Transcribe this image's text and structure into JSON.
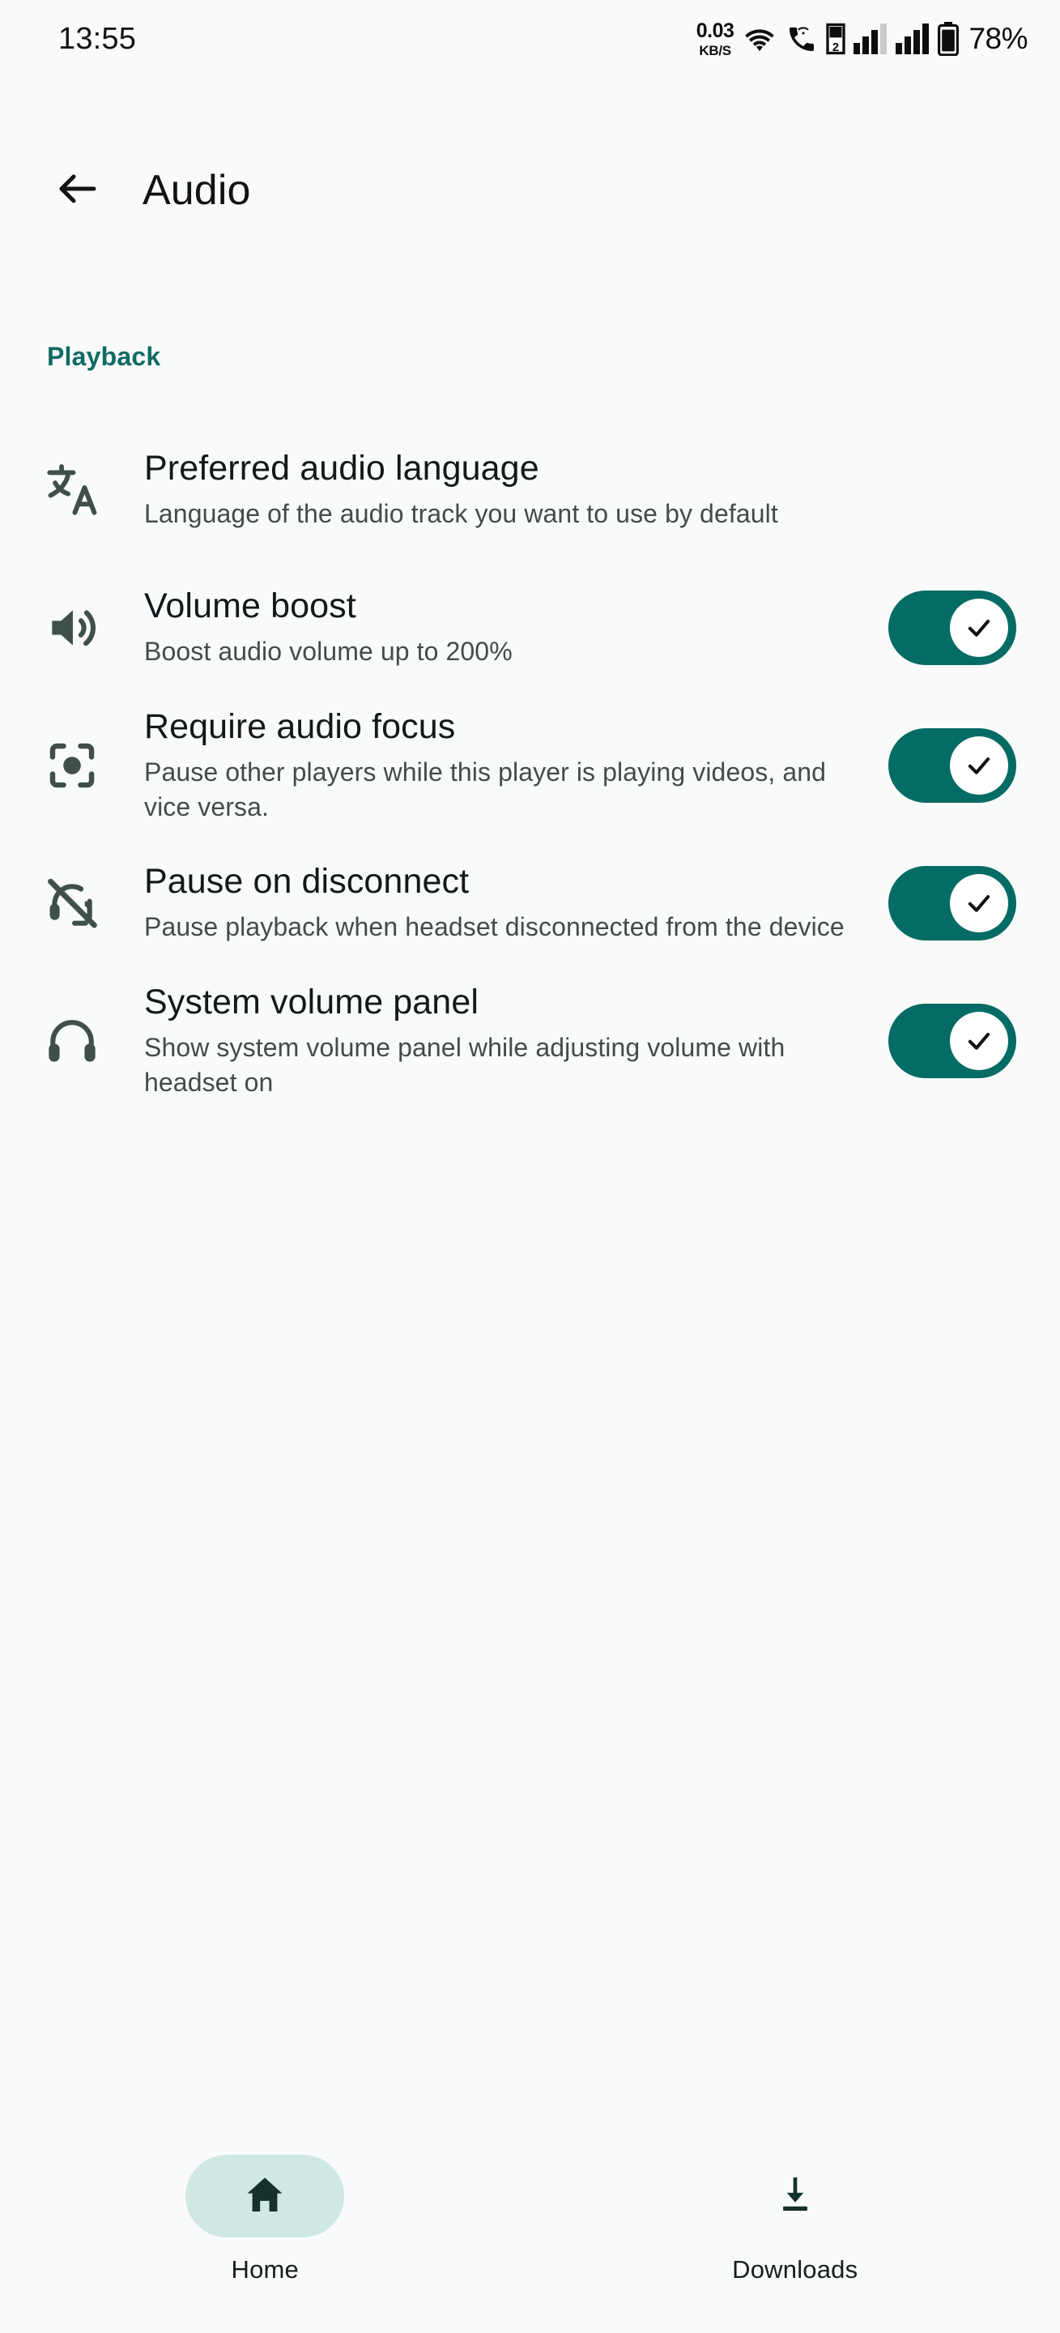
{
  "status_bar": {
    "time": "13:55",
    "network_speed_rate": "0.03",
    "network_speed_unit": "KB/S",
    "wifi_icon": "wifi-icon",
    "call_icon": "vowifi-call-icon",
    "sim_badge": "2",
    "signal_icon_1": "signal-bars-sim1-icon",
    "signal_icon_2": "signal-bars-sim2-icon",
    "battery_icon": "battery-icon",
    "battery_percent": "78%"
  },
  "app_bar": {
    "back_icon": "arrow-back-icon",
    "title": "Audio"
  },
  "section": {
    "playback_label": "Playback"
  },
  "colors": {
    "background": "#F9FBFA",
    "accent_teal": "#0E6B63",
    "switch_track_on": "#046C64",
    "icon": "#3F4F4C",
    "nav_pill_active": "#CFE8E4",
    "title_text": "#14181A",
    "subtitle_text": "#444B4A"
  },
  "preferences": [
    {
      "icon": "translate-icon",
      "title": "Preferred audio language",
      "subtitle": "Language of the audio track you want to use by default",
      "control": "none"
    },
    {
      "icon": "volume-up-icon",
      "title": "Volume boost",
      "subtitle": "Boost audio volume up to 200%",
      "control": "switch",
      "checked": "on"
    },
    {
      "icon": "center-focus-icon",
      "title": "Require audio focus",
      "subtitle": "Pause other players while this player is playing videos, and vice versa.",
      "control": "switch",
      "checked": "on"
    },
    {
      "icon": "headset-off-icon",
      "title": "Pause on disconnect",
      "subtitle": "Pause playback when headset disconnected from the device",
      "control": "switch",
      "checked": "on"
    },
    {
      "icon": "headphones-icon",
      "title": "System volume panel",
      "subtitle": "Show system volume panel while adjusting volume with headset on",
      "control": "switch",
      "checked": "on"
    }
  ],
  "bottom_nav": [
    {
      "icon": "home-icon",
      "label": "Home",
      "selected": "true"
    },
    {
      "icon": "download-icon",
      "label": "Downloads",
      "selected": "false"
    }
  ]
}
